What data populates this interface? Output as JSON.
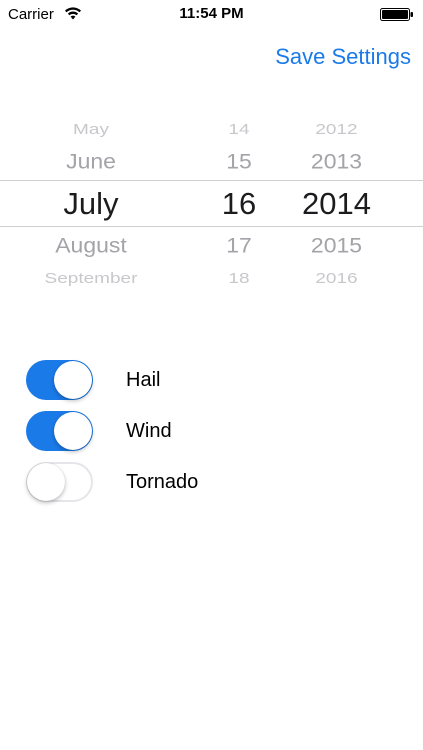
{
  "status_bar": {
    "carrier": "Carrier",
    "time": "11:54 PM",
    "wifi_icon": "wifi-icon",
    "battery_icon": "battery-icon"
  },
  "nav": {
    "save_label": "Save Settings",
    "accent_color": "#1a7ae8"
  },
  "date_picker": {
    "selected": {
      "month": "July",
      "day": "16",
      "year": "2014"
    },
    "months": [
      "May",
      "June",
      "July",
      "August",
      "September"
    ],
    "days": [
      "14",
      "15",
      "16",
      "17",
      "18"
    ],
    "years": [
      "2012",
      "2013",
      "2014",
      "2015",
      "2016"
    ]
  },
  "toggles": [
    {
      "label": "Hail",
      "state": "on"
    },
    {
      "label": "Wind",
      "state": "on"
    },
    {
      "label": "Tornado",
      "state": "off"
    }
  ]
}
